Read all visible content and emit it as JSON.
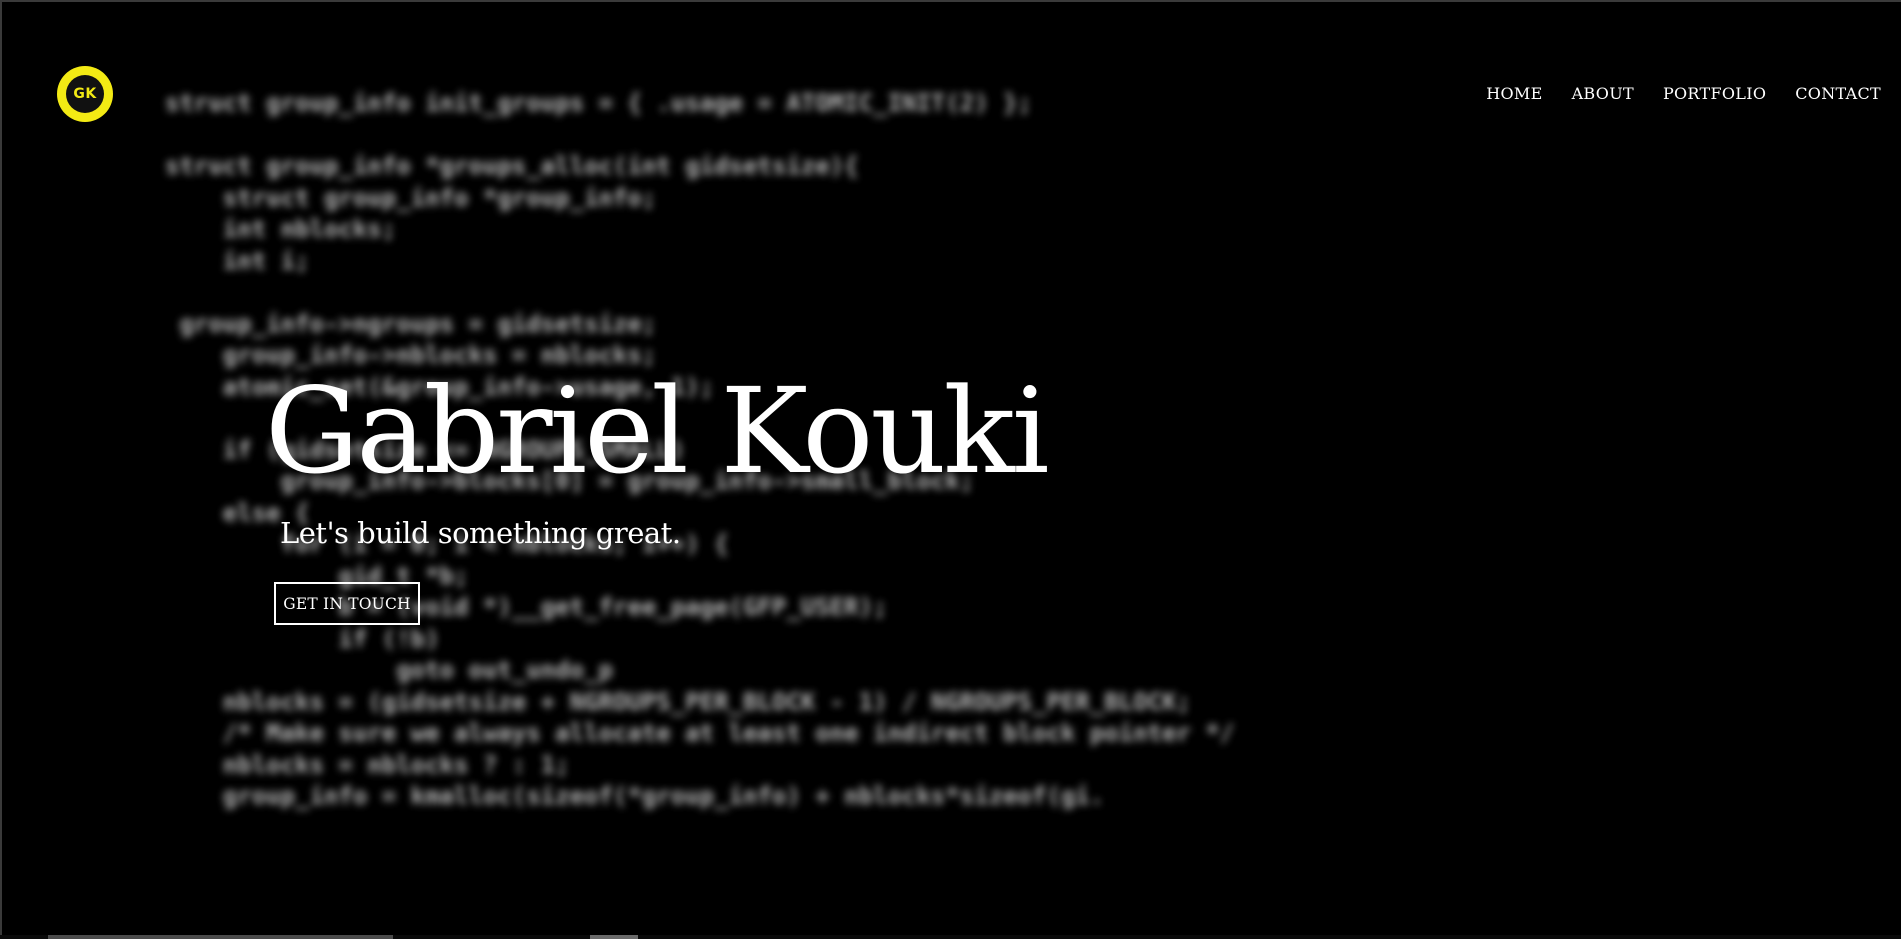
{
  "logo": {
    "text": "GK",
    "ring_color": "#f3ea14",
    "inner_color": "#111111"
  },
  "nav": {
    "items": [
      {
        "label": "HOME"
      },
      {
        "label": "ABOUT"
      },
      {
        "label": "PORTFOLIO"
      },
      {
        "label": "CONTACT"
      }
    ]
  },
  "hero": {
    "title": "Gabriel Kouki",
    "subtitle": "Let's build something great.",
    "cta_label": "GET IN TOUCH"
  },
  "background": {
    "code": "struct group_info init_groups = { .usage = ATOMIC_INIT(2) };\n\nstruct group_info *groups_alloc(int gidsetsize){\n    struct group_info *group_info;\n    int nblocks;\n    int i;\n\n group_info->ngroups = gidsetsize;\n    group_info->nblocks = nblocks;\n    atomic_set(&group_info->usage, 1);\n\n    if (gidsetsize <= NGROUPS_SMALL)\n        group_info->blocks[0] = group_info->small_block;\n    else {\n        for (i = 0; i < nblocks; i++) {\n            gid_t *b;\n            b = (void *)__get_free_page(GFP_USER);\n            if (!b)\n                goto out_undo_p\n    nblocks = (gidsetsize + NGROUPS_PER_BLOCK - 1) / NGROUPS_PER_BLOCK;\n    /* Make sure we always allocate at least one indirect block pointer */\n    nblocks = nblocks ? : 1;\n    group_info = kmalloc(sizeof(*group_info) + nblocks*sizeof(gi."
  },
  "colors": {
    "background": "#000000",
    "text": "#ffffff",
    "accent": "#f3ea14"
  }
}
